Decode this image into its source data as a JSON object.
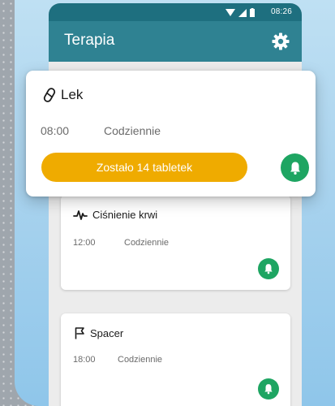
{
  "status_bar": {
    "time": "08:26"
  },
  "app_bar": {
    "title": "Terapia"
  },
  "cards": [
    {
      "name": "Lek",
      "time": "08:00",
      "frequency": "Codziennie",
      "remaining": "Zostało 14 tabletek"
    },
    {
      "name": "Ciśnienie krwi",
      "time": "12:00",
      "frequency": "Codziennie"
    },
    {
      "name": "Spacer",
      "time": "18:00",
      "frequency": "Codziennie"
    }
  ],
  "colors": {
    "status_bar": "#1e6f7f",
    "app_bar": "#2f8292",
    "accent_green": "#1ea562",
    "pill_amber": "#efab00"
  },
  "icons": {
    "settings": "gear-icon",
    "medication": "pill-icon",
    "blood_pressure": "pulse-icon",
    "walk": "flag-icon",
    "reminder": "bell-icon"
  }
}
